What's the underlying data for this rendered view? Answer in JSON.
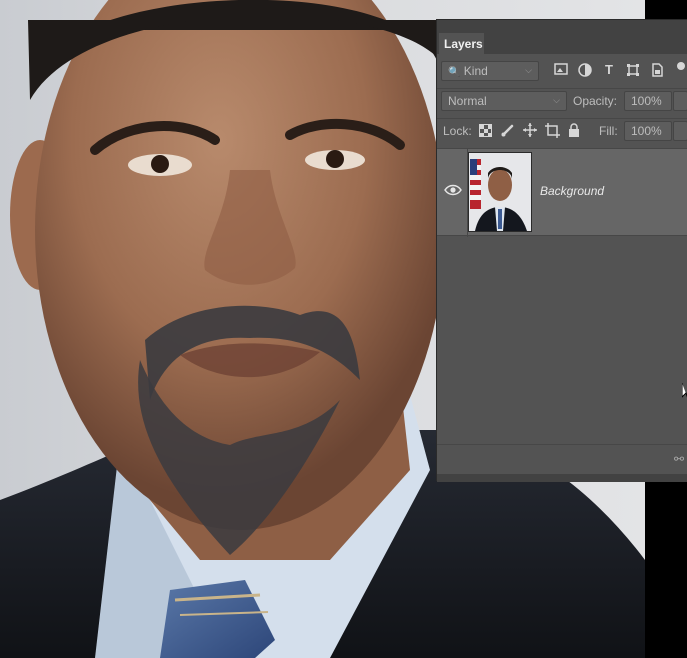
{
  "panel": {
    "tab": "Layers",
    "filter": {
      "value": "Kind"
    },
    "blend_mode": "Normal",
    "opacity_label": "Opacity:",
    "opacity_value": "100%",
    "lock_label": "Lock:",
    "fill_label": "Fill:",
    "fill_value": "100%",
    "filter_icons": [
      "image-filter-icon",
      "adjustment-filter-icon",
      "type-filter-icon",
      "shape-filter-icon",
      "smart-object-filter-icon"
    ],
    "lock_icons": [
      "lock-transparent-icon",
      "lock-image-icon",
      "lock-position-icon",
      "lock-artboard-icon",
      "lock-all-icon"
    ],
    "layers": [
      {
        "name": "Background",
        "visible": true
      }
    ]
  },
  "colors": {
    "panel_bg": "#535353",
    "tab_bar": "#424242",
    "selected_row": "#666666"
  }
}
